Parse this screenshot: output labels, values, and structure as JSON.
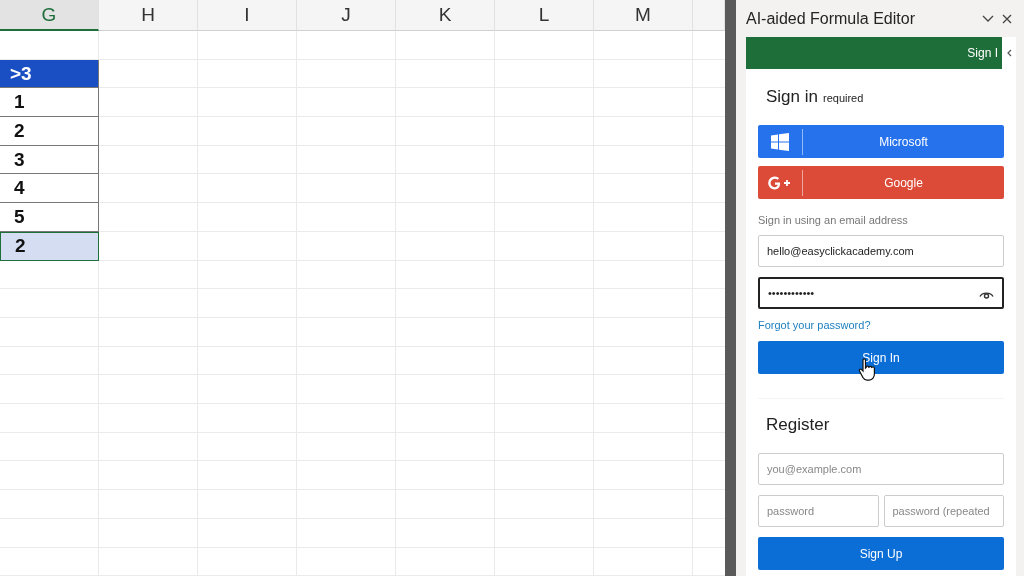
{
  "sheet": {
    "columns": [
      {
        "label": "G",
        "selected": true
      },
      {
        "label": "H",
        "selected": false
      },
      {
        "label": "I",
        "selected": false
      },
      {
        "label": "J",
        "selected": false
      },
      {
        "label": "K",
        "selected": false
      },
      {
        "label": "L",
        "selected": false
      },
      {
        "label": "M",
        "selected": false
      }
    ],
    "g_cells": [
      {
        "text": ">3",
        "kind": "header",
        "selected": false
      },
      {
        "text": "1",
        "kind": "value",
        "selected": false
      },
      {
        "text": "2",
        "kind": "value",
        "selected": false
      },
      {
        "text": "3",
        "kind": "value",
        "selected": false
      },
      {
        "text": "4",
        "kind": "value",
        "selected": false
      },
      {
        "text": "5",
        "kind": "value",
        "selected": false
      },
      {
        "text": "2",
        "kind": "value",
        "selected": true
      }
    ]
  },
  "pane": {
    "title": "AI-aided Formula Editor",
    "banner": "Sign I",
    "sign_in": {
      "heading": "Sign in",
      "note": "required",
      "providers": [
        {
          "label": "Microsoft",
          "kind": "microsoft"
        },
        {
          "label": "Google",
          "kind": "google"
        }
      ],
      "email_label": "Sign in using an email address",
      "email": {
        "value": "hello@easyclickacademy.com",
        "focused": false
      },
      "password": {
        "value": "••••••••••••",
        "focused": true
      },
      "forgot_link": "Forgot your password?",
      "button": "Sign In"
    },
    "register": {
      "heading": "Register",
      "email_placeholder": "you@example.com",
      "password_placeholder": "password",
      "repeat_placeholder": "password (repeated",
      "button": "Sign Up"
    }
  }
}
